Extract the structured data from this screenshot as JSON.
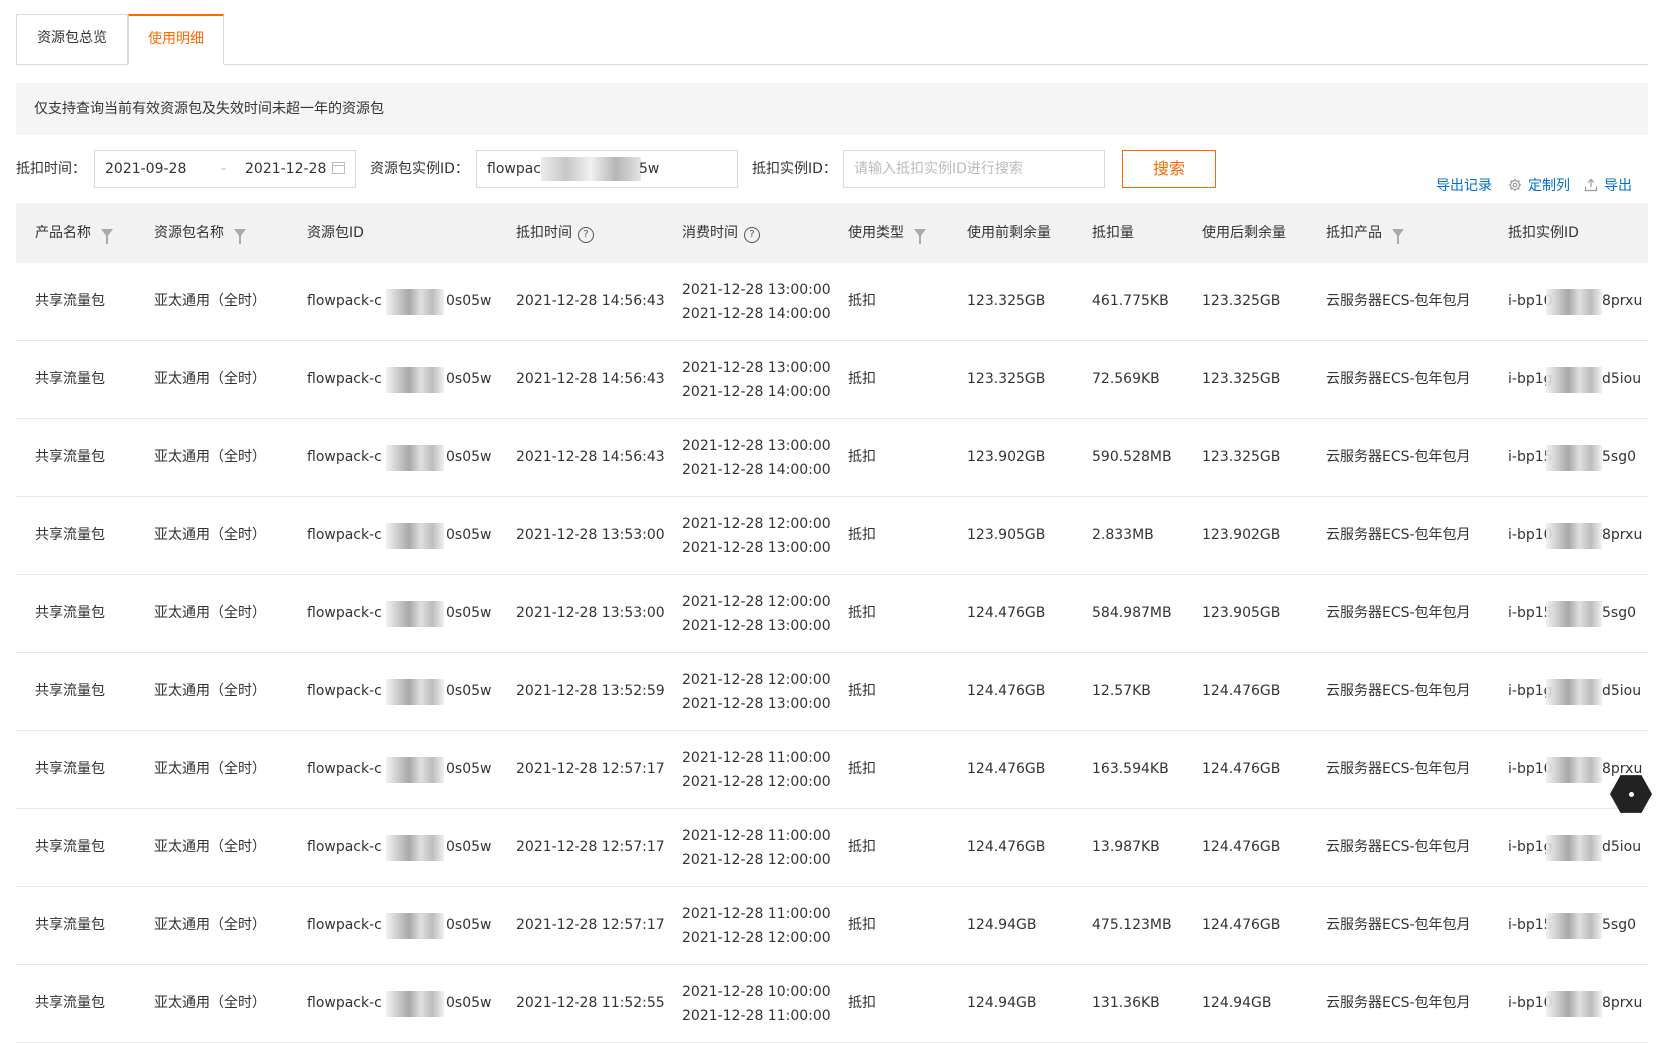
{
  "tabs": [
    {
      "label": "资源包总览",
      "active": false
    },
    {
      "label": "使用明细",
      "active": true
    }
  ],
  "notice": "仅支持查询当前有效资源包及失效时间未超一年的资源包",
  "filters": {
    "deduct_time_label": "抵扣时间：",
    "start_date": "2021-09-28",
    "date_separator": "-",
    "end_date": "2021-12-28",
    "package_id_label": "资源包实例ID：",
    "package_id_prefix": "flowpac",
    "package_id_suffix": "5w",
    "instance_id_label": "抵扣实例ID：",
    "instance_id_placeholder": "请输入抵扣实例ID进行搜索",
    "search_button": "搜索"
  },
  "actions": {
    "export_records": "导出记录",
    "customize_columns": "定制列",
    "export": "导出"
  },
  "table": {
    "headers": [
      "产品名称",
      "资源包名称",
      "资源包ID",
      "抵扣时间",
      "消费时间",
      "使用类型",
      "使用前剩余量",
      "抵扣量",
      "使用后剩余量",
      "抵扣产品",
      "抵扣实例ID"
    ],
    "rows": [
      {
        "product": "共享流量包",
        "package_name": "亚太通用（全时）",
        "package_id_pre": "flowpack-c",
        "package_id_suf": "0s05w",
        "deduct_time": "2021-12-28 14:56:43",
        "consume_start": "2021-12-28 13:00:00",
        "consume_end": "2021-12-28 14:00:00",
        "type": "抵扣",
        "before": "123.325GB",
        "amount": "461.775KB",
        "after": "123.325GB",
        "deduct_product": "云服务器ECS-包年包月",
        "instance_pre": "i-bp10",
        "instance_suf": "8prxu"
      },
      {
        "product": "共享流量包",
        "package_name": "亚太通用（全时）",
        "package_id_pre": "flowpack-c",
        "package_id_suf": "0s05w",
        "deduct_time": "2021-12-28 14:56:43",
        "consume_start": "2021-12-28 13:00:00",
        "consume_end": "2021-12-28 14:00:00",
        "type": "抵扣",
        "before": "123.325GB",
        "amount": "72.569KB",
        "after": "123.325GB",
        "deduct_product": "云服务器ECS-包年包月",
        "instance_pre": "i-bp1g",
        "instance_suf": "d5iou"
      },
      {
        "product": "共享流量包",
        "package_name": "亚太通用（全时）",
        "package_id_pre": "flowpack-c",
        "package_id_suf": "0s05w",
        "deduct_time": "2021-12-28 14:56:43",
        "consume_start": "2021-12-28 13:00:00",
        "consume_end": "2021-12-28 14:00:00",
        "type": "抵扣",
        "before": "123.902GB",
        "amount": "590.528MB",
        "after": "123.325GB",
        "deduct_product": "云服务器ECS-包年包月",
        "instance_pre": "i-bp15",
        "instance_suf": "5sg0"
      },
      {
        "product": "共享流量包",
        "package_name": "亚太通用（全时）",
        "package_id_pre": "flowpack-c",
        "package_id_suf": "0s05w",
        "deduct_time": "2021-12-28 13:53:00",
        "consume_start": "2021-12-28 12:00:00",
        "consume_end": "2021-12-28 13:00:00",
        "type": "抵扣",
        "before": "123.905GB",
        "amount": "2.833MB",
        "after": "123.902GB",
        "deduct_product": "云服务器ECS-包年包月",
        "instance_pre": "i-bp10",
        "instance_suf": "8prxu"
      },
      {
        "product": "共享流量包",
        "package_name": "亚太通用（全时）",
        "package_id_pre": "flowpack-c",
        "package_id_suf": "0s05w",
        "deduct_time": "2021-12-28 13:53:00",
        "consume_start": "2021-12-28 12:00:00",
        "consume_end": "2021-12-28 13:00:00",
        "type": "抵扣",
        "before": "124.476GB",
        "amount": "584.987MB",
        "after": "123.905GB",
        "deduct_product": "云服务器ECS-包年包月",
        "instance_pre": "i-bp15",
        "instance_suf": "5sg0"
      },
      {
        "product": "共享流量包",
        "package_name": "亚太通用（全时）",
        "package_id_pre": "flowpack-c",
        "package_id_suf": "0s05w",
        "deduct_time": "2021-12-28 13:52:59",
        "consume_start": "2021-12-28 12:00:00",
        "consume_end": "2021-12-28 13:00:00",
        "type": "抵扣",
        "before": "124.476GB",
        "amount": "12.57KB",
        "after": "124.476GB",
        "deduct_product": "云服务器ECS-包年包月",
        "instance_pre": "i-bp1g",
        "instance_suf": "d5iou"
      },
      {
        "product": "共享流量包",
        "package_name": "亚太通用（全时）",
        "package_id_pre": "flowpack-c",
        "package_id_suf": "0s05w",
        "deduct_time": "2021-12-28 12:57:17",
        "consume_start": "2021-12-28 11:00:00",
        "consume_end": "2021-12-28 12:00:00",
        "type": "抵扣",
        "before": "124.476GB",
        "amount": "163.594KB",
        "after": "124.476GB",
        "deduct_product": "云服务器ECS-包年包月",
        "instance_pre": "i-bp10",
        "instance_suf": "8prxu"
      },
      {
        "product": "共享流量包",
        "package_name": "亚太通用（全时）",
        "package_id_pre": "flowpack-c",
        "package_id_suf": "0s05w",
        "deduct_time": "2021-12-28 12:57:17",
        "consume_start": "2021-12-28 11:00:00",
        "consume_end": "2021-12-28 12:00:00",
        "type": "抵扣",
        "before": "124.476GB",
        "amount": "13.987KB",
        "after": "124.476GB",
        "deduct_product": "云服务器ECS-包年包月",
        "instance_pre": "i-bp1g",
        "instance_suf": "d5iou"
      },
      {
        "product": "共享流量包",
        "package_name": "亚太通用（全时）",
        "package_id_pre": "flowpack-c",
        "package_id_suf": "0s05w",
        "deduct_time": "2021-12-28 12:57:17",
        "consume_start": "2021-12-28 11:00:00",
        "consume_end": "2021-12-28 12:00:00",
        "type": "抵扣",
        "before": "124.94GB",
        "amount": "475.123MB",
        "after": "124.476GB",
        "deduct_product": "云服务器ECS-包年包月",
        "instance_pre": "i-bp15",
        "instance_suf": "5sg0"
      },
      {
        "product": "共享流量包",
        "package_name": "亚太通用（全时）",
        "package_id_pre": "flowpack-c",
        "package_id_suf": "0s05w",
        "deduct_time": "2021-12-28 11:52:55",
        "consume_start": "2021-12-28 10:00:00",
        "consume_end": "2021-12-28 11:00:00",
        "type": "抵扣",
        "before": "124.94GB",
        "amount": "131.36KB",
        "after": "124.94GB",
        "deduct_product": "云服务器ECS-包年包月",
        "instance_pre": "i-bp10",
        "instance_suf": "8prxu"
      }
    ]
  },
  "colors": {
    "accent": "#ff6a00",
    "link": "#0070cc"
  }
}
